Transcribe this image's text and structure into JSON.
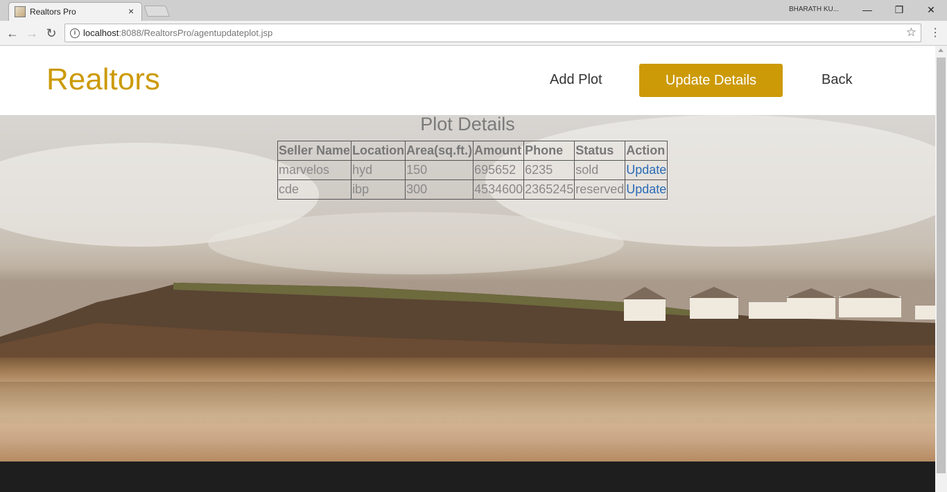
{
  "browser": {
    "tab_title": "Realtors Pro",
    "tab_close": "×",
    "profile_name": "BHARATH KU...",
    "window_controls": {
      "minimize": "—",
      "restore": "❐",
      "close": "✕"
    },
    "nav": {
      "back": "←",
      "forward": "→",
      "reload": "↻"
    },
    "url_host": "localhost",
    "url_rest": ":8088/RealtorsPro/agentupdateplot.jsp",
    "bookmark_icon": "star-icon",
    "menu_glyph": "⋮"
  },
  "header": {
    "brand": "Realtors",
    "brand_color": "#cc9a06",
    "nav": {
      "add_plot": "Add Plot",
      "update_details": "Update Details",
      "back": "Back"
    }
  },
  "main": {
    "title": "Plot Details",
    "table": {
      "columns": [
        "Seller Name",
        "Location",
        "Area(sq.ft.)",
        "Amount",
        "Phone",
        "Status",
        "Action"
      ],
      "rows": [
        [
          "marvelos",
          "hyd",
          "150",
          "695652",
          "6235",
          "sold",
          "Update"
        ],
        [
          "cde",
          "ibp",
          "300",
          "4534600",
          "2365245",
          "reserved",
          "Update"
        ]
      ]
    }
  }
}
